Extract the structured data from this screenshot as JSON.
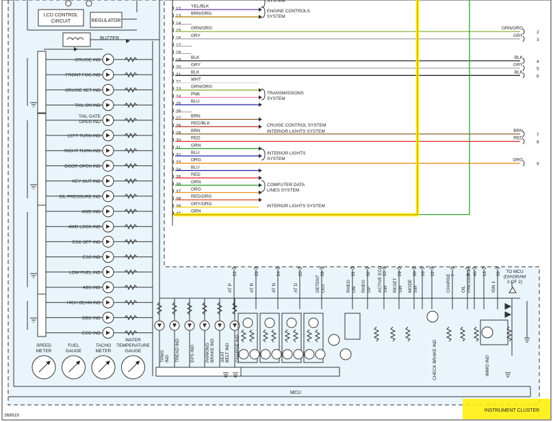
{
  "modules": {
    "lcd_control": [
      "LCD CONTROL",
      "CIRCUIT"
    ],
    "regulator": "REGULATOR",
    "buzzer": "BUZZER",
    "mcu": "MCU",
    "cluster_label": "INSTRUMENT CLUSTER",
    "doc_id": "368919"
  },
  "left_indicators": [
    "CRUISE IND",
    "FRONT FOG IND",
    "CRUISE SET IND",
    "TAIL ON IND",
    "TAIL GATE|OPEN IND",
    "LEFT TURN IND",
    "RIGHT TURN IND",
    "DOOR OPEN IND",
    "KEY OUT IND",
    "OIL PRESSURE IND",
    "4WD IND",
    "4WD LOCK IND",
    "ESC OFF IND",
    "ESC IND",
    "LOW FUEL IND",
    "ABS IND",
    "HIGH BEAM IND",
    "DBC IND",
    "ECO IND"
  ],
  "gauges": [
    [
      "SPEED",
      "METER"
    ],
    [
      "FUEL",
      "GAUGE"
    ],
    [
      "TACHO",
      "METER"
    ],
    [
      "WATER",
      "TEMPERATURE",
      "GAUGE"
    ]
  ],
  "bottom_indicators": [
    [
      "TPMS",
      "IND"
    ],
    [
      "TREAD IND"
    ],
    [
      "EPS IND"
    ],
    [
      "PARKING",
      "BRAKE IND"
    ],
    [
      "SEAT",
      "BELT IND"
    ],
    [
      "CHARGE IND"
    ]
  ],
  "terminals": [
    {
      "label": "AT P",
      "pin": "22"
    },
    {
      "label": "AT R",
      "pin": "23"
    },
    {
      "label": "AT N",
      "pin": "24"
    },
    {
      "label": "AT D",
      "pin": "25"
    },
    {
      "label": "DETENT OUT",
      "pin": "28"
    },
    {
      "label": "RHEO DN",
      "pin": "31"
    },
    {
      "label": "RHEO UP",
      "pin": "32"
    },
    {
      "label": "ACTIVE ECO SW",
      "pin": "15"
    },
    {
      "label": "RESET SW",
      "pin": "29"
    },
    {
      "label": "MODE SW",
      "pin": "30"
    },
    {
      "label": "",
      "pin": "16"
    },
    {
      "label": "",
      "pin": "12"
    },
    {
      "label": "CHARGE",
      "pin": "7"
    },
    {
      "label": "OIL PRESSURE",
      "pin": "9"
    },
    {
      "label": "",
      "pin": "40"
    },
    {
      "label": "",
      "pin": "13"
    },
    {
      "label": "IGN 1",
      "pin": "39"
    }
  ],
  "check_brake": "CHECK BRAKE IND",
  "immo_ind": "IMMO IND",
  "to_mcu": [
    "TO MCU",
    "(DIAGRAM",
    "2 OF 2)"
  ],
  "connector_wires": [
    {
      "pin": "12",
      "color": "YEL/BLK"
    },
    {
      "pin": "13",
      "color": "BRN/ORG"
    },
    {
      "pin": "14",
      "color": ""
    },
    {
      "pin": "15",
      "color": "GRN/ORG"
    },
    {
      "pin": "16",
      "color": "GRY"
    },
    {
      "pin": "17",
      "color": ""
    },
    {
      "pin": "18",
      "color": ""
    },
    {
      "pin": "19",
      "color": "BLK"
    },
    {
      "pin": "20",
      "color": "GRY"
    },
    {
      "pin": "21",
      "color": "BLK"
    },
    {
      "pin": "22",
      "color": "WHT"
    },
    {
      "pin": "23",
      "color": "GRN/ORG"
    },
    {
      "pin": "24",
      "color": "PNK"
    },
    {
      "pin": "25",
      "color": "BLU"
    },
    {
      "pin": "26",
      "color": ""
    },
    {
      "pin": "27",
      "color": "BRN"
    },
    {
      "pin": "28",
      "color": "RED/BLK"
    },
    {
      "pin": "29",
      "color": "BRN"
    },
    {
      "pin": "30",
      "color": "RED"
    },
    {
      "pin": "31",
      "color": "GRN"
    },
    {
      "pin": "32",
      "color": "BLU"
    },
    {
      "pin": "33",
      "color": "ORG"
    },
    {
      "pin": "34",
      "color": "BLU"
    },
    {
      "pin": "35",
      "color": "RED"
    },
    {
      "pin": "36",
      "color": "GRN"
    },
    {
      "pin": "37",
      "color": "ORG"
    },
    {
      "pin": "38",
      "color": "RED/ORG"
    },
    {
      "pin": "39",
      "color": "GRY/ORG"
    },
    {
      "pin": "40",
      "color": "GRN"
    }
  ],
  "wire_groups": [
    {
      "lines": [
        "SYSTEM"
      ]
    },
    {
      "lines": [
        "ENGINE CONTROLS",
        "SYSTEM"
      ]
    },
    {
      "lines": [
        "TRANSMISSIONS",
        "SYSTEM"
      ]
    },
    {
      "lines": [
        "CRUISE CONTROL SYSTEM"
      ]
    },
    {
      "lines": [
        "INTERIOR LIGHTS SYSTEM"
      ]
    },
    {
      "lines": [
        "INTERIOR LIGHTS",
        "SYSTEM"
      ]
    },
    {
      "lines": [
        "COMPUTER DATA",
        "LINES SYSTEM"
      ]
    },
    {
      "lines": [
        "INTERIOR LIGHTS SYSTEM"
      ]
    }
  ],
  "right_ends": [
    {
      "color": "GRN/ORG",
      "num": "2"
    },
    {
      "color": "GRY",
      "num": "3"
    },
    {
      "color": "BLK",
      "num": "4"
    },
    {
      "color": "GRY",
      "num": "5"
    },
    {
      "color": "BLK",
      "num": "6"
    },
    {
      "color": "BRN",
      "num": "7"
    },
    {
      "color": "RED",
      "num": "8"
    },
    {
      "color": "ORG",
      "num": "9"
    }
  ],
  "wire_colors": {
    "YEL/BLK": "#6f30b0",
    "BRN/ORG": "#b8860b",
    "GRN/ORG": "#8db33a",
    "GRY": "#a8a8a8",
    "BLK": "#222222",
    "WHT": "#d8d8d8",
    "PNK": "#ff7fb0",
    "BLU": "#1a1aa6",
    "BRN": "#8b5a2b",
    "RED/BLK": "#c0392b",
    "RED": "#e02020",
    "GRN": "#2ca02c",
    "ORG": "#f08c1e",
    "RED/ORG": "#e0502a",
    "GRY/ORG": "#f0c800"
  },
  "highlight_color": "#ffee00",
  "panel_fill": "#e9f5fb"
}
